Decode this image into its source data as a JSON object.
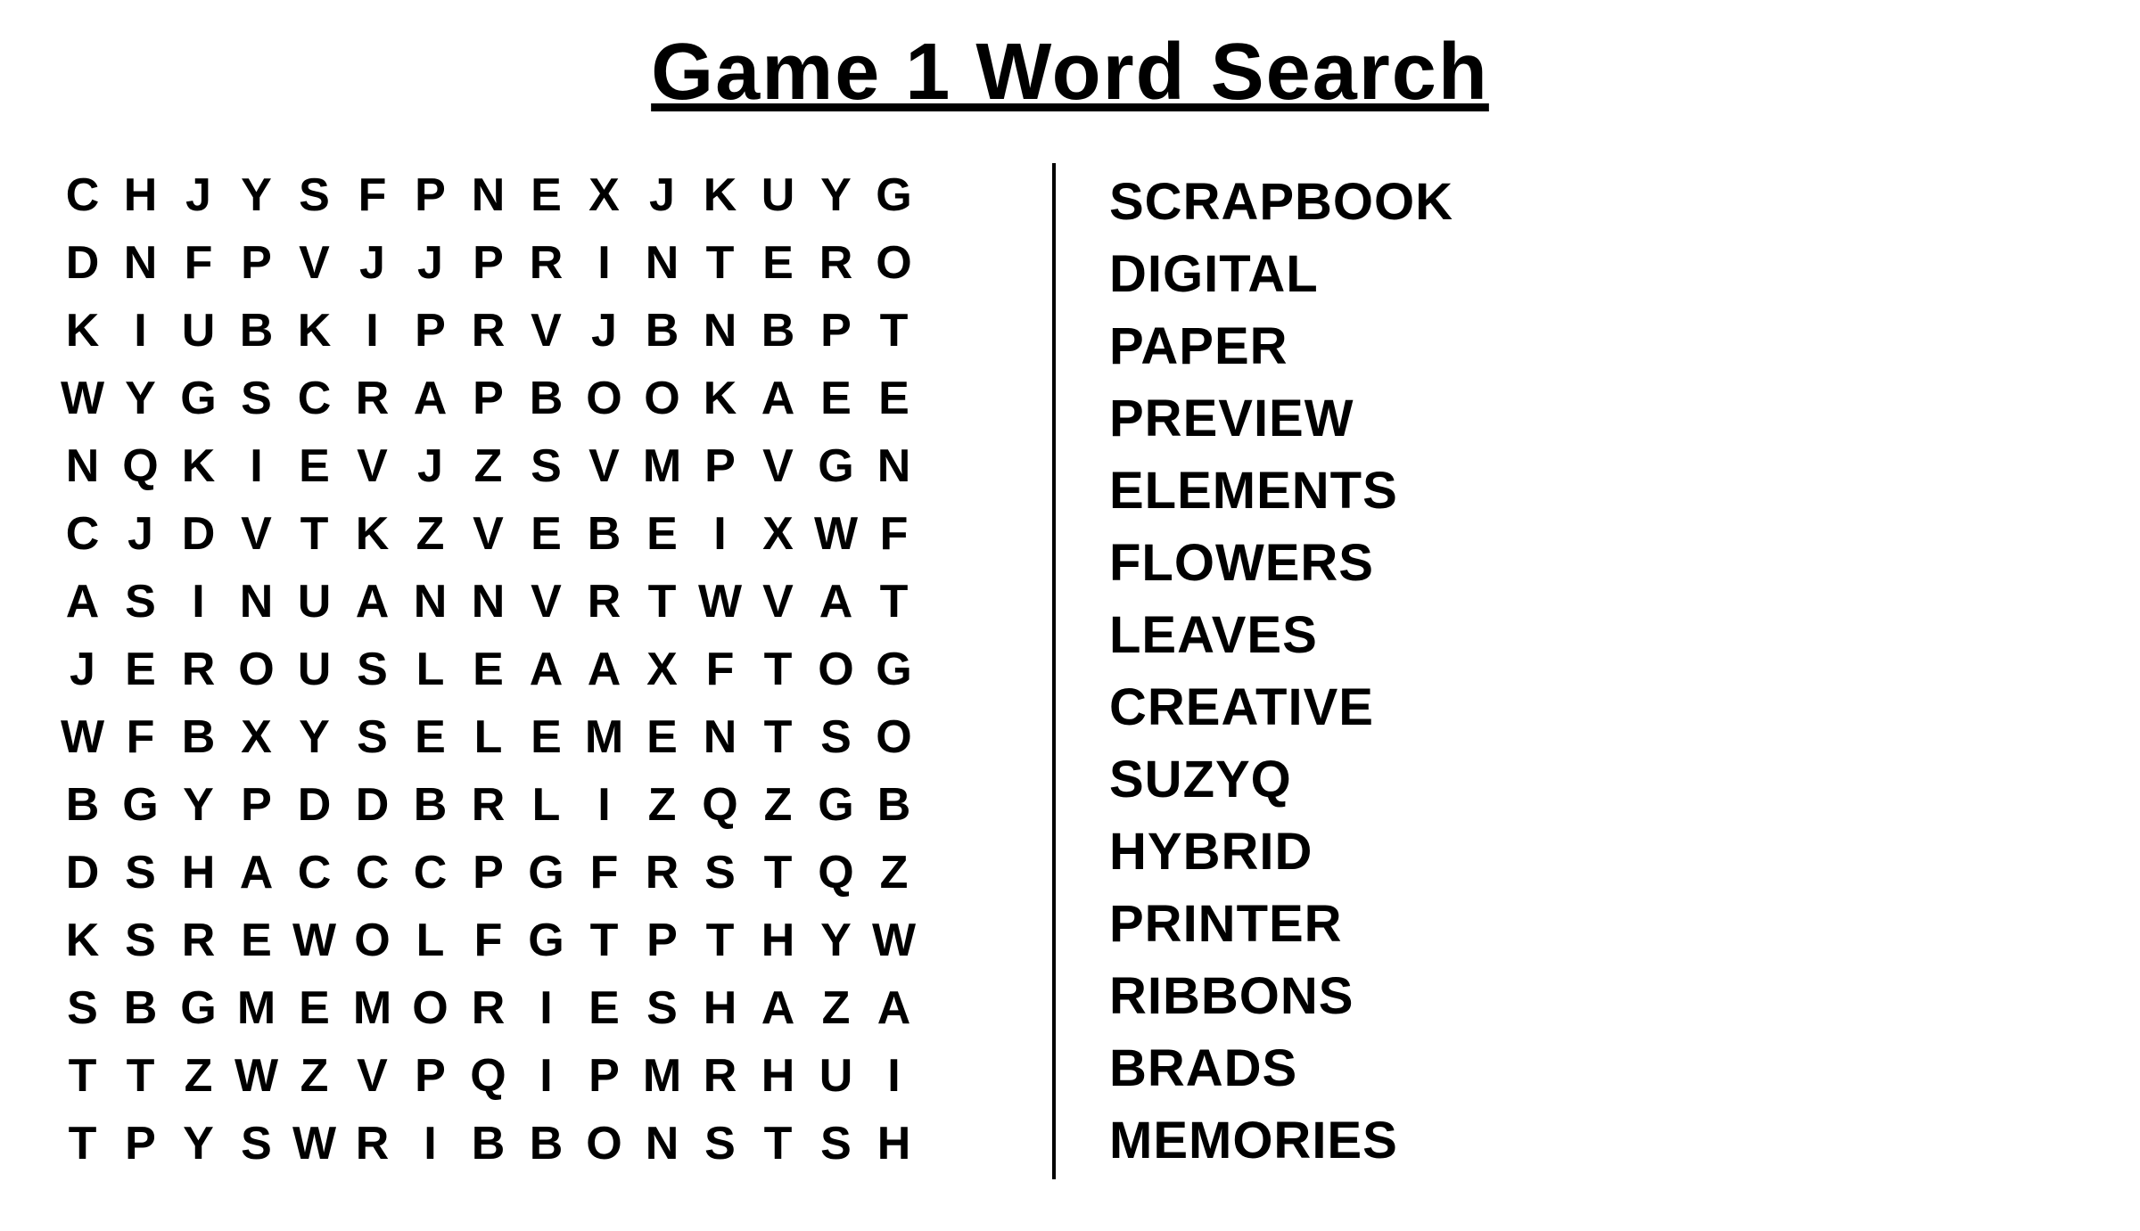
{
  "title": "Game 1 Word Search",
  "grid": [
    [
      "C",
      "H",
      "J",
      "Y",
      "S",
      "F",
      "P",
      "N",
      "E",
      "X",
      "J",
      "K",
      "U",
      "Y",
      "G"
    ],
    [
      "D",
      "N",
      "F",
      "P",
      "V",
      "J",
      "J",
      "P",
      "R",
      "I",
      "N",
      "T",
      "E",
      "R",
      "O"
    ],
    [
      "K",
      "I",
      "U",
      "B",
      "K",
      "I",
      "P",
      "R",
      "V",
      "J",
      "B",
      "N",
      "B",
      "P",
      "T"
    ],
    [
      "W",
      "Y",
      "G",
      "S",
      "C",
      "R",
      "A",
      "P",
      "B",
      "O",
      "O",
      "K",
      "A",
      "E",
      "E"
    ],
    [
      "N",
      "Q",
      "K",
      "I",
      "E",
      "V",
      "J",
      "Z",
      "S",
      "V",
      "M",
      "P",
      "V",
      "G",
      "N"
    ],
    [
      "C",
      "J",
      "D",
      "V",
      "T",
      "K",
      "Z",
      "V",
      "E",
      "B",
      "E",
      "I",
      "X",
      "W",
      "F"
    ],
    [
      "A",
      "S",
      "I",
      "N",
      "U",
      "A",
      "N",
      "N",
      "V",
      "R",
      "T",
      "W",
      "V",
      "A",
      "T"
    ],
    [
      "J",
      "E",
      "R",
      "O",
      "U",
      "S",
      "L",
      "E",
      "A",
      "A",
      "X",
      "F",
      "T",
      "O",
      "G"
    ],
    [
      "W",
      "F",
      "B",
      "X",
      "Y",
      "S",
      "E",
      "L",
      "E",
      "M",
      "E",
      "N",
      "T",
      "S",
      "O"
    ],
    [
      "B",
      "G",
      "Y",
      "P",
      "D",
      "D",
      "B",
      "R",
      "L",
      "I",
      "Z",
      "Q",
      "Z",
      "G",
      "B"
    ],
    [
      "D",
      "S",
      "H",
      "A",
      "C",
      "C",
      "C",
      "P",
      "G",
      "F",
      "R",
      "S",
      "T",
      "Q",
      "Z"
    ],
    [
      "K",
      "S",
      "R",
      "E",
      "W",
      "O",
      "L",
      "F",
      "G",
      "T",
      "P",
      "T",
      "H",
      "Y",
      "W"
    ],
    [
      "S",
      "B",
      "G",
      "M",
      "E",
      "M",
      "O",
      "R",
      "I",
      "E",
      "S",
      "H",
      "A",
      "Z",
      "A"
    ],
    [
      "T",
      "T",
      "Z",
      "W",
      "Z",
      "V",
      "P",
      "Q",
      "I",
      "P",
      "M",
      "R",
      "H",
      "U",
      "I"
    ],
    [
      "T",
      "P",
      "Y",
      "S",
      "W",
      "R",
      "I",
      "B",
      "B",
      "O",
      "N",
      "S",
      "T",
      "S",
      "H"
    ]
  ],
  "words": [
    "SCRAPBOOK",
    "DIGITAL",
    "PAPER",
    "PREVIEW",
    "ELEMENTS",
    "FLOWERS",
    "LEAVES",
    "CREATIVE",
    "SUZYQ",
    "HYBRID",
    "PRINTER",
    "RIBBONS",
    "BRADS",
    "MEMORIES"
  ]
}
